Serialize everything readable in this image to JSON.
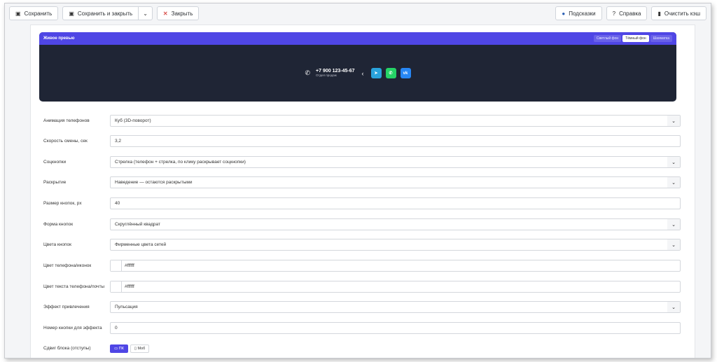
{
  "toolbar": {
    "save": "Сохранить",
    "save_close": "Сохранить и закрыть",
    "close": "Закрыть",
    "hints": "Подсказки",
    "help": "Справка",
    "clear_cache": "Очистить кэш"
  },
  "preview": {
    "title": "Живое превью",
    "bg_options": [
      "Светлый фон",
      "Тёмный фон",
      "Шахматка"
    ],
    "bg_selected": "Тёмный фон",
    "phone": "+7 900 123-45-67",
    "phone_sub": "Отдел продаж",
    "social": [
      "telegram",
      "whatsapp",
      "vk"
    ]
  },
  "fields": [
    {
      "label": "Анимация телефонов",
      "value": "Куб (3D-поворот)",
      "type": "select"
    },
    {
      "label": "Скорость смены, сек",
      "value": "3,2",
      "type": "input"
    },
    {
      "label": "Соцкнопки",
      "value": "Стрелка (телефон + стрелка, по клику раскрывает соцкнопки)",
      "type": "select"
    },
    {
      "label": "Раскрытие",
      "value": "Наведение — остаются раскрытыми",
      "type": "select"
    },
    {
      "label": "Размер кнопок, px",
      "value": "40",
      "type": "input"
    },
    {
      "label": "Форма кнопок",
      "value": "Скруглённый квадрат",
      "type": "select"
    },
    {
      "label": "Цвета кнопок",
      "value": "Фирменные цвета сетей",
      "type": "select"
    },
    {
      "label": "Цвет телефона/иконок",
      "value": "#ffffff",
      "type": "color"
    },
    {
      "label": "Цвет текста телефона/почты",
      "value": "#ffffff",
      "type": "color"
    },
    {
      "label": "Эффект привлечения",
      "value": "Пульсация",
      "type": "select"
    },
    {
      "label": "Номер кнопки для эффекта",
      "value": "0",
      "type": "input"
    }
  ],
  "offset": {
    "label": "Сдвиг блока (отступы)",
    "pc": "ПК",
    "mobile": "Моб"
  },
  "colors": {
    "accent": "#4f46e5",
    "preview_bg": "#1f2535"
  }
}
